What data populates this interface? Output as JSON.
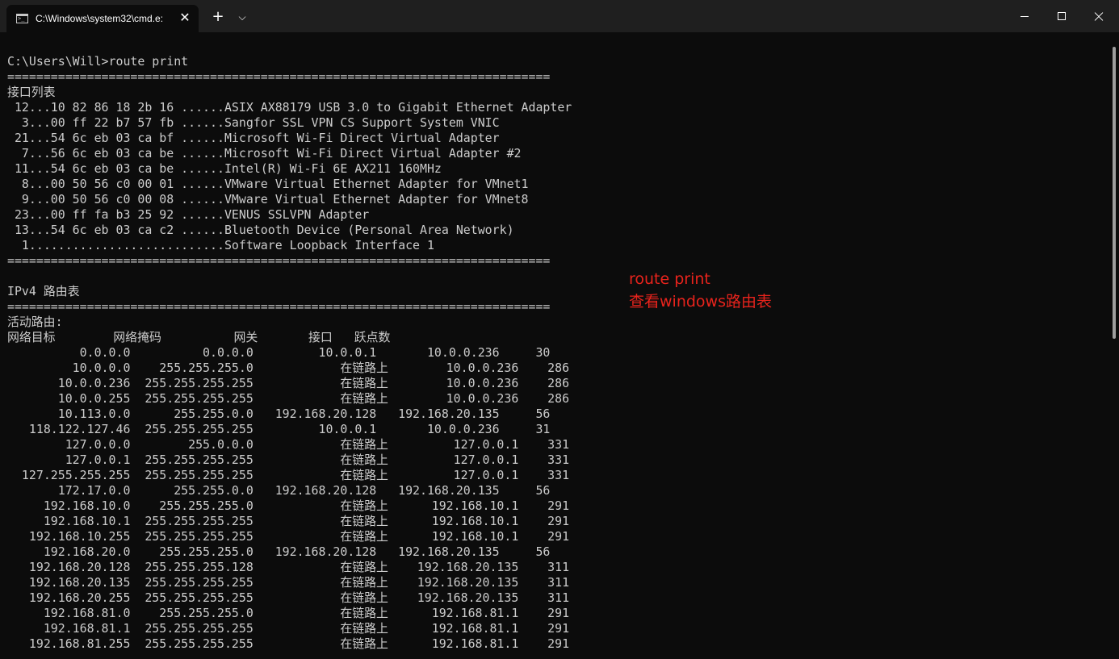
{
  "window": {
    "tab_title": "C:\\Windows\\system32\\cmd.e:",
    "tab_close_symbol": "✕",
    "new_tab_symbol": "+",
    "dropdown_symbol": "⌵",
    "accent_color": "#1f1f1f",
    "background_color": "#0c0c0c",
    "text_color": "#cccccc"
  },
  "terminal": {
    "lines": [
      "",
      "C:\\Users\\Will>route print",
      "===========================================================================",
      "接口列表",
      " 12...10 82 86 18 2b 16 ......ASIX AX88179 USB 3.0 to Gigabit Ethernet Adapter",
      "  3...00 ff 22 b7 57 fb ......Sangfor SSL VPN CS Support System VNIC",
      " 21...54 6c eb 03 ca bf ......Microsoft Wi-Fi Direct Virtual Adapter",
      "  7...56 6c eb 03 ca be ......Microsoft Wi-Fi Direct Virtual Adapter #2",
      " 11...54 6c eb 03 ca be ......Intel(R) Wi-Fi 6E AX211 160MHz",
      "  8...00 50 56 c0 00 01 ......VMware Virtual Ethernet Adapter for VMnet1",
      "  9...00 50 56 c0 00 08 ......VMware Virtual Ethernet Adapter for VMnet8",
      " 23...00 ff fa b3 25 92 ......VENUS SSLVPN Adapter",
      " 13...54 6c eb 03 ca c2 ......Bluetooth Device (Personal Area Network)",
      "  1...........................Software Loopback Interface 1",
      "===========================================================================",
      "",
      "IPv4 路由表",
      "===========================================================================",
      "活动路由:",
      "网络目标        网络掩码          网关       接口   跃点数",
      "          0.0.0.0          0.0.0.0         10.0.0.1       10.0.0.236     30",
      "         10.0.0.0    255.255.255.0            在链路上        10.0.0.236    286",
      "       10.0.0.236  255.255.255.255            在链路上        10.0.0.236    286",
      "       10.0.0.255  255.255.255.255            在链路上        10.0.0.236    286",
      "       10.113.0.0      255.255.0.0   192.168.20.128   192.168.20.135     56",
      "   118.122.127.46  255.255.255.255         10.0.0.1       10.0.0.236     31",
      "        127.0.0.0        255.0.0.0            在链路上         127.0.0.1    331",
      "        127.0.0.1  255.255.255.255            在链路上         127.0.0.1    331",
      "  127.255.255.255  255.255.255.255            在链路上         127.0.0.1    331",
      "       172.17.0.0      255.255.0.0   192.168.20.128   192.168.20.135     56",
      "     192.168.10.0    255.255.255.0            在链路上      192.168.10.1    291",
      "     192.168.10.1  255.255.255.255            在链路上      192.168.10.1    291",
      "   192.168.10.255  255.255.255.255            在链路上      192.168.10.1    291",
      "     192.168.20.0    255.255.255.0   192.168.20.128   192.168.20.135     56",
      "   192.168.20.128  255.255.255.128            在链路上    192.168.20.135    311",
      "   192.168.20.135  255.255.255.255            在链路上    192.168.20.135    311",
      "   192.168.20.255  255.255.255.255            在链路上    192.168.20.135    311",
      "     192.168.81.0    255.255.255.0            在链路上      192.168.81.1    291",
      "     192.168.81.1  255.255.255.255            在链路上      192.168.81.1    291",
      "   192.168.81.255  255.255.255.255            在链路上      192.168.81.1    291"
    ]
  },
  "annotation": {
    "line1": "route print",
    "line2": "查看windows路由表",
    "color": "#e8231c"
  }
}
